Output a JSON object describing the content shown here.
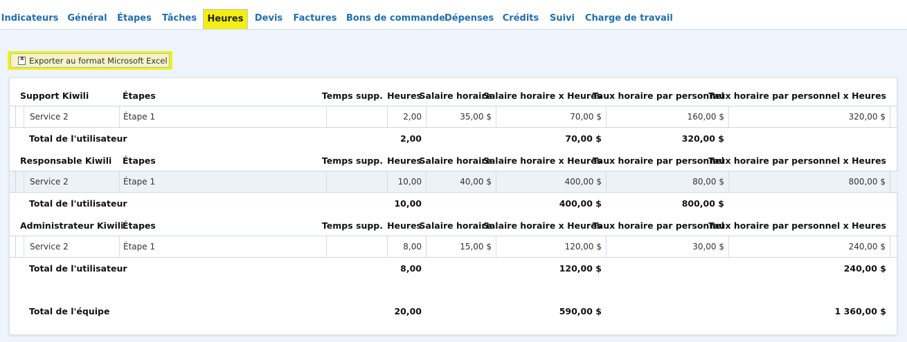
{
  "tabs": [
    {
      "label": "Indicateurs",
      "active": false
    },
    {
      "label": "Général",
      "active": false
    },
    {
      "label": "Étapes",
      "active": false
    },
    {
      "label": "Tâches",
      "active": false
    },
    {
      "label": "Heures",
      "active": true
    },
    {
      "label": "Devis",
      "active": false
    },
    {
      "label": "Factures",
      "active": false
    },
    {
      "label": "Bons de commande",
      "active": false
    },
    {
      "label": "Dépenses",
      "active": false
    },
    {
      "label": "Crédits",
      "active": false
    },
    {
      "label": "Suivi",
      "active": false
    },
    {
      "label": "Charge de travail",
      "active": false
    }
  ],
  "export": {
    "label": "Exporter au format Microsoft Excel"
  },
  "columns": {
    "etapes": "Étapes",
    "temps_supp": "Temps supp.",
    "heures": "Heures",
    "salaire_horaire": "Salaire horaire",
    "salaire_x_heures": "Salaire horaire x Heures",
    "taux_horaire": "Taux horaire par personnel",
    "taux_x_heures": "Taux horaire par personnel x Heures"
  },
  "groups": [
    {
      "user": "Support Kiwili",
      "highlighted": false,
      "row": {
        "service": "Service 2",
        "etape": "Étape 1",
        "temps_supp": "",
        "heures": "2,00",
        "salaire_horaire": "35,00 $",
        "salaire_x_heures": "70,00 $",
        "taux_horaire": "160,00 $",
        "taux_x_heures": "320,00 $"
      },
      "total": {
        "label": "Total de l'utilisateur",
        "heures": "2,00",
        "salaire_x_heures": "70,00 $",
        "taux_horaire": "320,00 $",
        "taux_x_heures": ""
      }
    },
    {
      "user": "Responsable Kiwili",
      "highlighted": true,
      "row": {
        "service": "Service 2",
        "etape": "Étape 1",
        "temps_supp": "",
        "heures": "10,00",
        "salaire_horaire": "40,00 $",
        "salaire_x_heures": "400,00 $",
        "taux_horaire": "80,00 $",
        "taux_x_heures": "800,00 $"
      },
      "total": {
        "label": "Total de l'utilisateur",
        "heures": "10,00",
        "salaire_x_heures": "400,00 $",
        "taux_horaire": "800,00 $",
        "taux_x_heures": ""
      }
    },
    {
      "user": "Administrateur Kiwili",
      "highlighted": false,
      "row": {
        "service": "Service 2",
        "etape": "Étape 1",
        "temps_supp": "",
        "heures": "8,00",
        "salaire_horaire": "15,00 $",
        "salaire_x_heures": "120,00 $",
        "taux_horaire": "30,00 $",
        "taux_x_heures": "240,00 $"
      },
      "total": {
        "label": "Total de l'utilisateur",
        "heures": "8,00",
        "salaire_x_heures": "120,00 $",
        "taux_horaire": "",
        "taux_x_heures": "240,00 $"
      }
    }
  ],
  "team_total": {
    "label": "Total de l'équipe",
    "heures": "20,00",
    "salaire_x_heures": "590,00 $",
    "taux_x_heures": "1 360,00 $"
  }
}
